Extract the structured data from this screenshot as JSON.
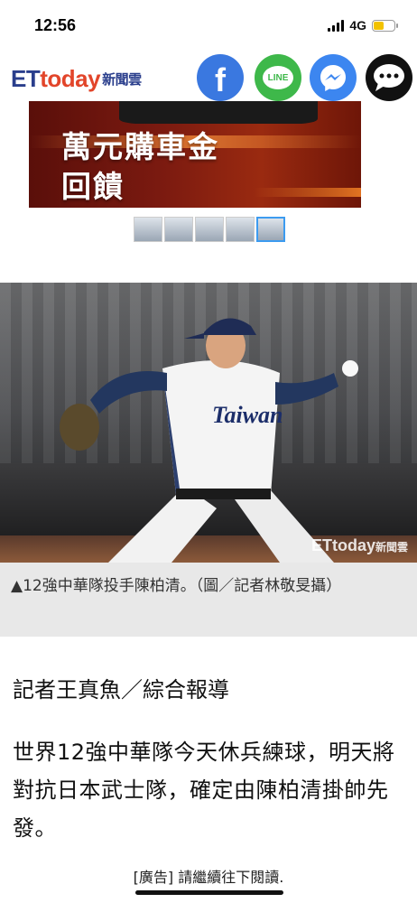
{
  "status_bar": {
    "time": "12:56",
    "network": "4G"
  },
  "brand": {
    "logo_et": "ET",
    "logo_today": "today",
    "logo_sub": "新聞雲"
  },
  "share": {
    "facebook": "f",
    "line": "LINE"
  },
  "ad_banner": {
    "line1": "萬元購車金",
    "line2": "回饋"
  },
  "photo": {
    "watermark": "ETtoday",
    "watermark_sub": "新聞雲"
  },
  "article": {
    "caption": "▲12強中華隊投手陳柏清。（圖／記者林敬旻攝）",
    "byline": "記者王真魚／綜合報導",
    "lead": "世界12強中華隊今天休兵練球，明天將對抗日本武士隊，確定由陳柏清掛帥先發。"
  },
  "ad_notice": "[廣告] 請繼續往下閱讀.",
  "colors": {
    "brand_blue": "#2a3e8c",
    "brand_red": "#e2452a",
    "facebook": "#3a78e0",
    "line": "#3eb84a",
    "messenger": "#3c86f0"
  }
}
